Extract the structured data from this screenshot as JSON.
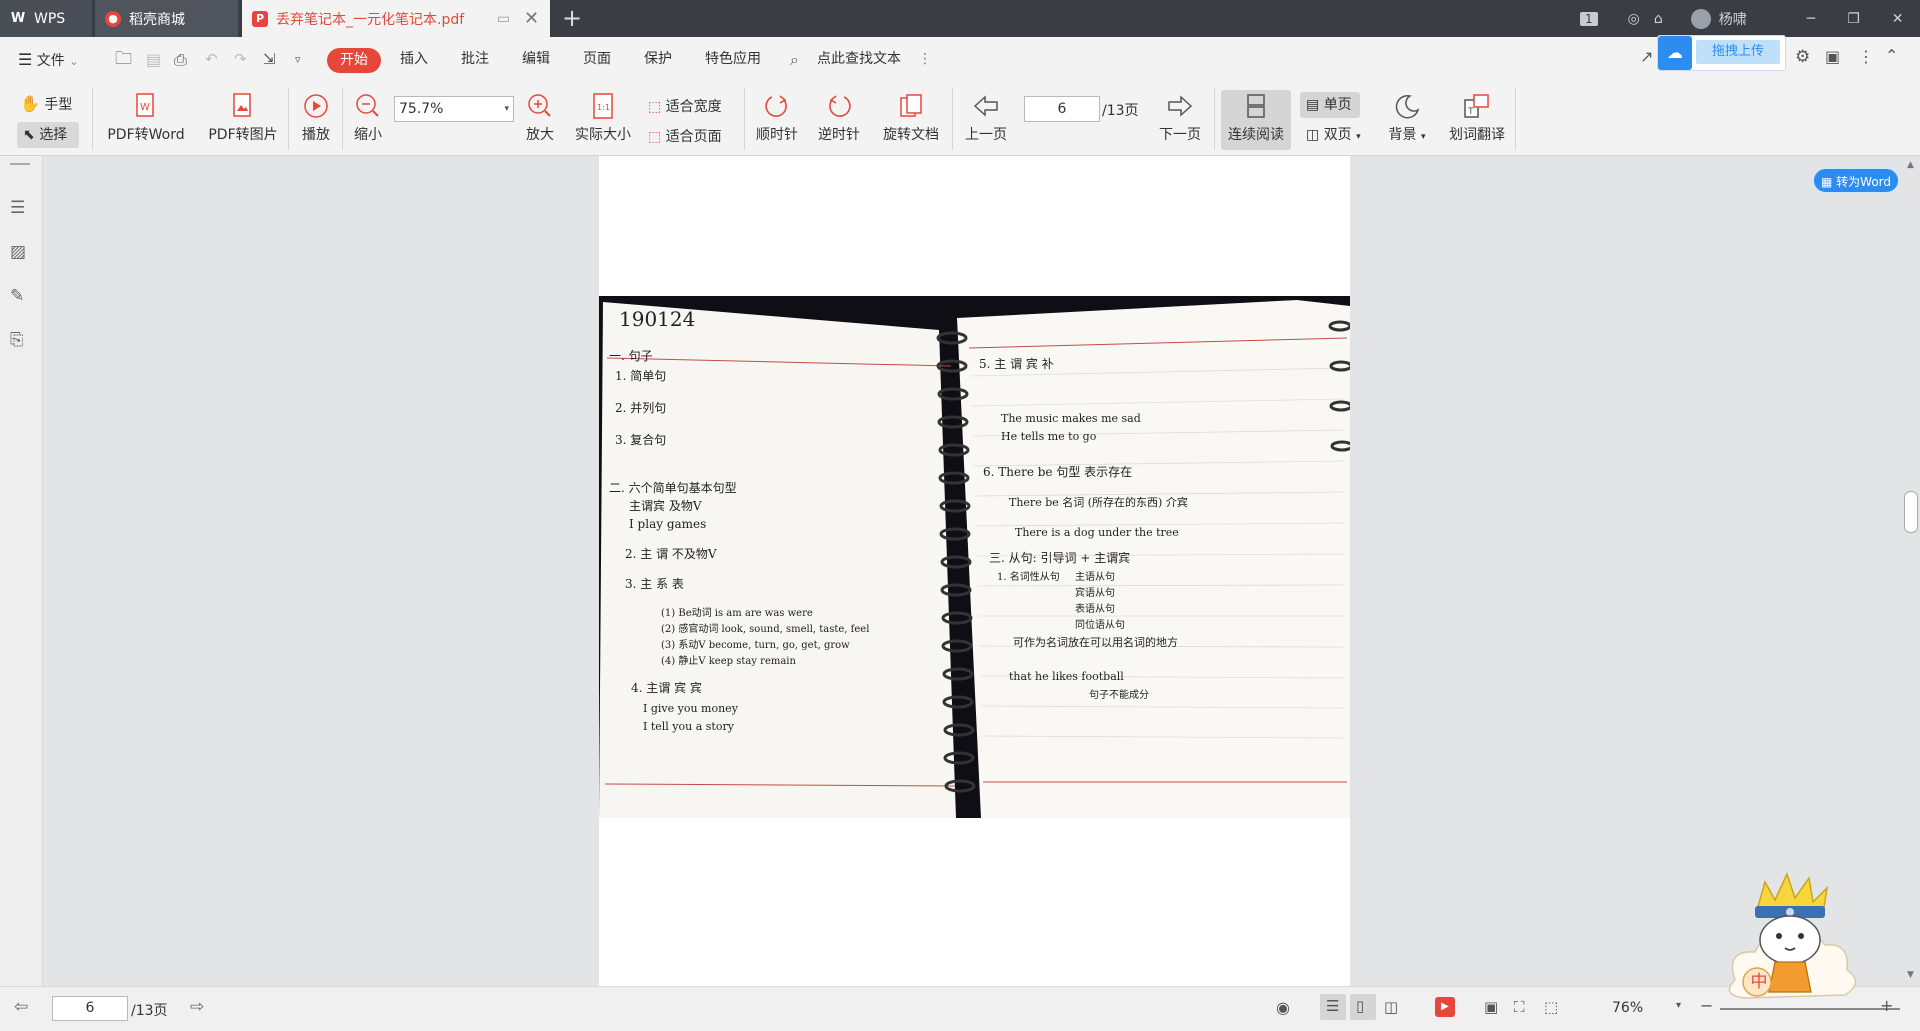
{
  "tabs": {
    "wps": "WPS",
    "store": "稻壳商城",
    "doc": "丢弃笔记本_一元化笔记本.pdf"
  },
  "titlebar": {
    "badge": "1",
    "user": "杨啸"
  },
  "menu": {
    "file": "文件",
    "start": "开始",
    "insert": "插入",
    "annotate": "批注",
    "edit": "编辑",
    "page": "页面",
    "protect": "保护",
    "special": "特色应用",
    "search": "点此查找文本",
    "upload": "拖拽上传"
  },
  "toolbar": {
    "hand": "手型",
    "select": "选择",
    "pdf_to_word": "PDF转Word",
    "pdf_to_image": "PDF转图片",
    "play": "播放",
    "zoom_out": "缩小",
    "zoom_value": "75.7%",
    "zoom_in": "放大",
    "actual_size": "实际大小",
    "fit_width": "适合宽度",
    "fit_page": "适合页面",
    "clockwise": "顺时针",
    "counterclockwise": "逆时针",
    "rotate_doc": "旋转文档",
    "prev_page": "上一页",
    "page_value": "6",
    "page_total": "/13页",
    "next_page": "下一页",
    "continuous": "连续阅读",
    "single": "单页",
    "double": "双页",
    "background": "背景",
    "translate": "划词翻译"
  },
  "float_button": "转为Word",
  "statusbar": {
    "page_value": "6",
    "page_total": "/13页",
    "zoom": "76%"
  },
  "ime": "中",
  "notes": {
    "date": "190124",
    "left": [
      "一. 句子",
      "1. 简单句",
      "2. 并列句",
      "3. 复合句",
      "二. 六个简单句基本句型",
      "主谓宾  及物V",
      "I play games",
      "2. 主 谓   不及物V",
      "3. 主 系 表",
      "(1) Be动词 is am are was were",
      "(2) 感官动词 look, sound, smell, taste, feel",
      "(3) 系动V  become, turn, go, get, grow",
      "(4) 静止V  keep stay remain",
      "4. 主谓 宾 宾",
      "I give you money",
      "I tell you a story"
    ],
    "right": [
      "5. 主 谓 宾 补",
      "The music makes me sad",
      "He tells me to go",
      "6. There be 句型  表示存在",
      "There be 名词 (所存在的东西) 介宾",
      "There is a dog under the tree",
      "三. 从句: 引导词 + 主谓宾",
      "1. 名词性从句",
      "主语从句",
      "宾语从句",
      "表语从句",
      "同位语从句",
      "可作为名词放在可以用名词的地方",
      "that he likes football",
      "句子不能成分"
    ]
  }
}
